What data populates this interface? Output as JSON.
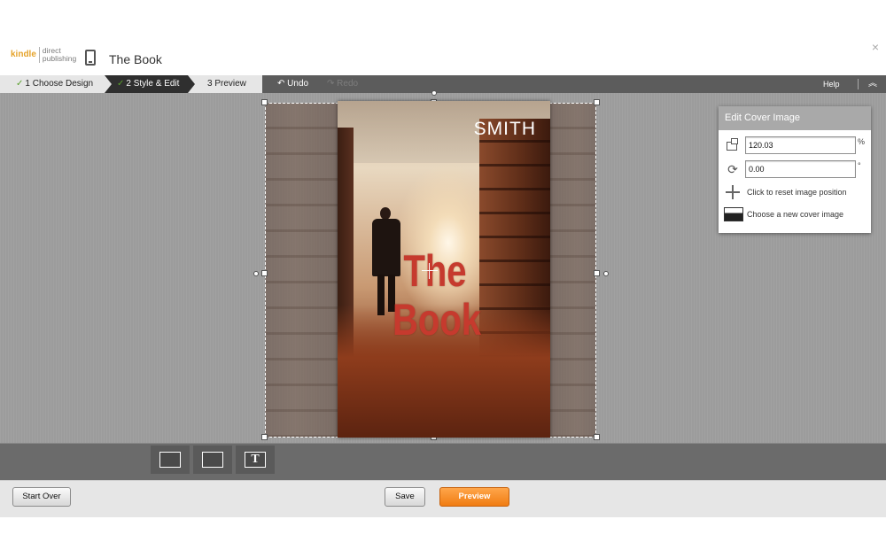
{
  "header": {
    "logo_kindle": "kindle",
    "logo_direct": "direct",
    "logo_publishing": "publishing",
    "book_title": "The Book",
    "close_label": "×",
    "device_icon": "tablet-icon"
  },
  "steps": [
    {
      "label": "1 Choose Design",
      "done": true
    },
    {
      "label": "2 Style & Edit",
      "done": true
    },
    {
      "label": "3 Preview",
      "done": false
    }
  ],
  "history": {
    "undo_label": "Undo",
    "redo_label": "Redo"
  },
  "help_label": "Help",
  "cover": {
    "author": "SMITH",
    "title_line1": "The",
    "title_line2": "Book"
  },
  "edit_panel": {
    "title": "Edit Cover Image",
    "scale_value": "120.03",
    "scale_unit": "%",
    "rotation_value": "0.00",
    "rotation_unit": "°",
    "reset_label": "Click to reset image position",
    "choose_label": "Choose a new cover image"
  },
  "footer": {
    "start_over": "Start Over",
    "save": "Save",
    "preview": "Preview"
  },
  "colors": {
    "accent_orange": "#f07c12",
    "step_active": "#2f2f2f",
    "check_green": "#5aa02c",
    "title_red": "#c63a2e"
  }
}
